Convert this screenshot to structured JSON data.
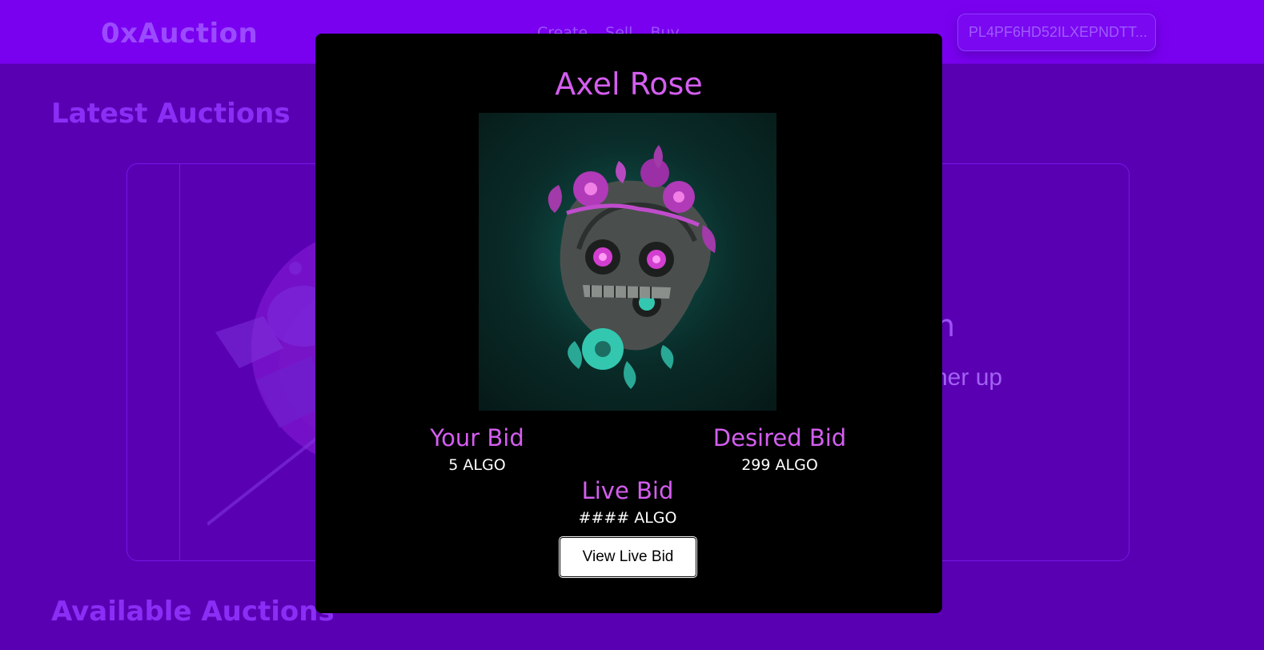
{
  "navbar": {
    "brand": "0xAuction",
    "links": [
      "Create",
      "Sell",
      "Buy"
    ],
    "wallet_address": "PL4PF6HD52ILXEPNDTT..."
  },
  "sections": {
    "latest_title": "Latest Auctions",
    "available_title": "Available Auctions"
  },
  "featured_card": {
    "title_fragment": "n",
    "subtitle_fragment": "her up"
  },
  "modal": {
    "title": "Axel Rose",
    "your_bid_label": "Your Bid",
    "your_bid_value": "5 ALGO",
    "desired_bid_label": "Desired Bid",
    "desired_bid_value": "299 ALGO",
    "live_bid_label": "Live Bid",
    "live_bid_value": "#### ALGO",
    "view_live_bid_button": "View Live Bid"
  },
  "colors": {
    "page_background": "#5a00b3",
    "navbar": "#7a00f0",
    "accent_pink": "#d45ef0",
    "modal_background": "#000000",
    "nft_background": "#0a2e2b"
  }
}
